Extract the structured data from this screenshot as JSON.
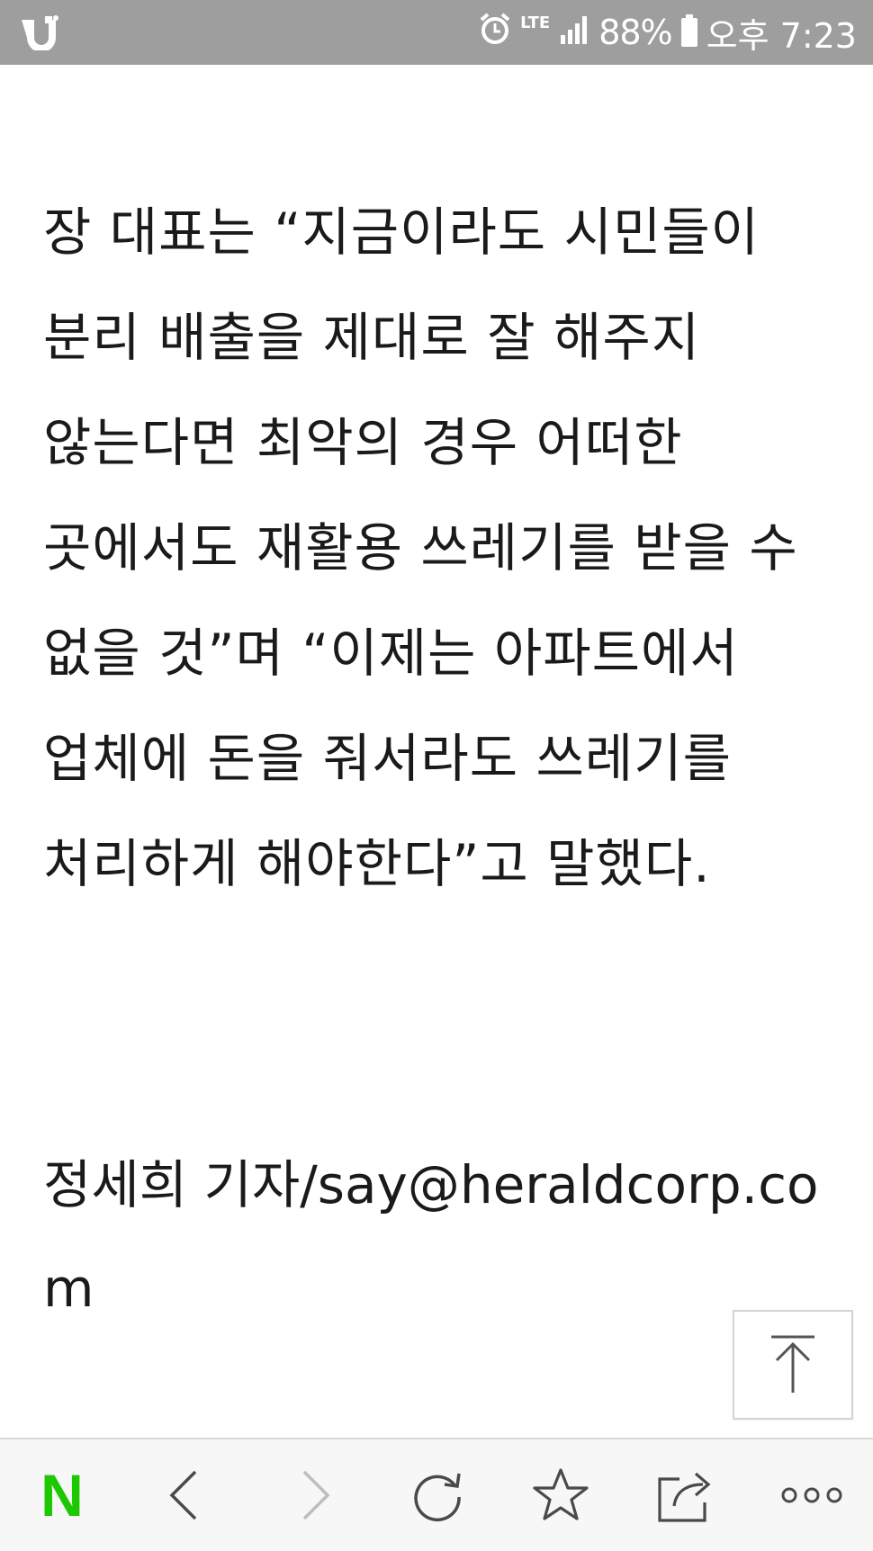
{
  "status_bar": {
    "network": "LTE",
    "battery_percent": "88%",
    "time": "오후 7:23",
    "icons": [
      "u-plus-logo-icon",
      "alarm-icon",
      "lte-data-icon",
      "signal-icon",
      "battery-icon"
    ]
  },
  "article": {
    "paragraph": "장 대표는 “지금이라도 시민들이 분리 배출을 제대로 잘 해주지 않는다면 최악의 경우 어떠한 곳에서도 재활용 쓰레기를 받을 수 없을 것”며 “이제는 아파트에서 업체에 돈을 줘서라도 쓰레기를 처리하게 해야한다”고 말했다.",
    "byline": "정세희 기자/say@heraldcorp.com"
  },
  "scroll_top": {
    "icon": "arrow-up-icon"
  },
  "toolbar": {
    "brand_letter": "N",
    "brand_color": "#1ec800",
    "icons": [
      "naver-logo-icon",
      "back-icon",
      "forward-icon",
      "refresh-icon",
      "bookmark-star-icon",
      "share-icon",
      "more-icon"
    ]
  }
}
